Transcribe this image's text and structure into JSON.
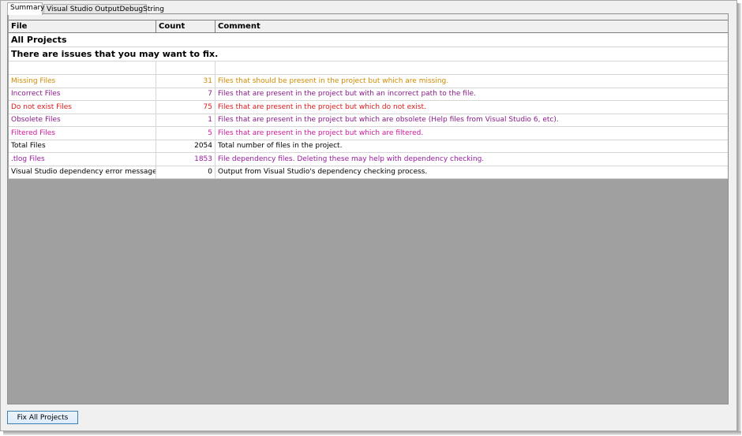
{
  "tabs": [
    {
      "label": "Summary",
      "active": true
    },
    {
      "label": "Visual Studio OutputDebugString",
      "active": false
    }
  ],
  "table": {
    "columns": [
      "File",
      "Count",
      "Comment"
    ],
    "section_title": "All Projects",
    "issues_message": "There are issues that you may want to fix.",
    "rows": [
      {
        "file": "Missing Files",
        "count": "31",
        "comment": "Files that should be present in the project but which are missing.",
        "color": "#d08a00"
      },
      {
        "file": "Incorrect Files",
        "count": "7",
        "comment": "Files that are present in the project but with an incorrect path to the file.",
        "color": "#8b1a8b"
      },
      {
        "file": "Do not exist Files",
        "count": "75",
        "comment": "Files that are present in the project but which do not exist.",
        "color": "#e01818"
      },
      {
        "file": "Obsolete Files",
        "count": "1",
        "comment": "Files that are present in the project but which are obsolete (Help files from Visual Studio 6, etc).",
        "color": "#8b1a8b"
      },
      {
        "file": "Filtered Files",
        "count": "5",
        "comment": "Files that are present in the project but which are filtered.",
        "color": "#d0179c"
      },
      {
        "file": "Total Files",
        "count": "2054",
        "comment": "Total number of files in the project.",
        "color": "#000000"
      },
      {
        "file": ".tlog Files",
        "count": "1853",
        "comment": "File dependency files. Deleting these may help with dependency checking.",
        "color": "#9a1aa0"
      },
      {
        "file": "Visual Studio dependency error messages",
        "count": "0",
        "comment": "Output from Visual Studio's dependency checking process.",
        "color": "#000000"
      }
    ]
  },
  "buttons": {
    "fix_all": "Fix All Projects"
  }
}
